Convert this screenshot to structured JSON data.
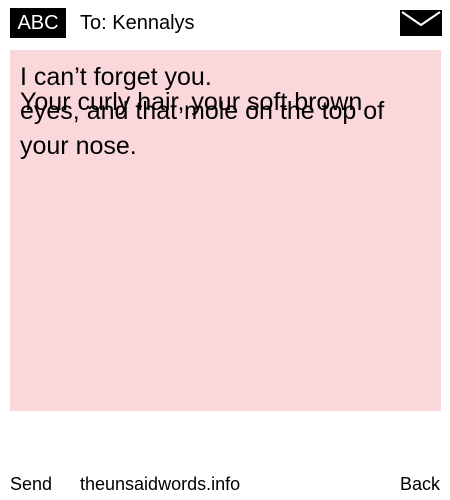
{
  "header": {
    "badge_label": "ABC",
    "to_label": "To: Kennalys",
    "mail_icon": "envelope-icon"
  },
  "message": {
    "lines": [
      "I can’t forget you.",
      "Your curly hair, your soft brown",
      "eyes, and that mole on the top of",
      "your nose."
    ],
    "background_color": "#f9d7da"
  },
  "footer": {
    "send_label": "Send",
    "site_label": "theunsaidwords.info",
    "back_label": "Back"
  }
}
